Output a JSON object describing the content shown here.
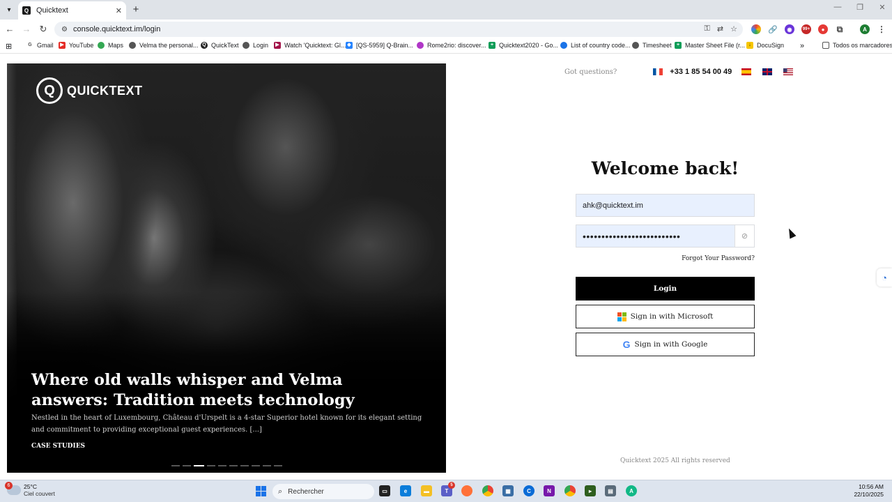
{
  "browser": {
    "tab_title": "Quicktext",
    "url": "console.quicktext.im/login",
    "bookmarks": [
      "Gmail",
      "YouTube",
      "Maps",
      "Velma the personal...",
      "QuickText",
      "Login",
      "Watch 'Quicktext: Gl...",
      "[QS-5959] Q-Brain...",
      "Rome2rio: discover...",
      "Quicktext2020 - Go...",
      "List of country code...",
      "Timesheet",
      "Master Sheet File (r...",
      "DocuSign"
    ],
    "all_bookmarks": "Todos os marcadores",
    "ext_badge": "99+"
  },
  "hero": {
    "logo_text": "QUICKTEXT",
    "title": "Where old walls whisper and Velma answers: Tradition meets technology",
    "description": "Nestled in the heart of Luxembourg, Château d'Urspelt is a 4-star Superior hotel known for its elegant setting and commitment to providing exceptional guest experiences. [...]",
    "tag": "CASE STUDIES",
    "slides_total": 10,
    "slide_active": 3
  },
  "topbar": {
    "got_questions": "Got questions?",
    "phone": "+33 1 85 54 00 49"
  },
  "login": {
    "title": "Welcome back!",
    "email_value": "ahk@quicktext.im",
    "password_value": "••••••••••••••••••••••••••",
    "forgot": "Forgot Your Password?",
    "login_button": "Login",
    "microsoft_button": "Sign in with Microsoft",
    "google_button": "Sign in with Google"
  },
  "footer": "Quicktext 2025 All rights reserved",
  "taskbar": {
    "weather_badge": "6",
    "temperature": "25°C",
    "weather_desc": "Ciel couvert",
    "search_placeholder": "Rechercher",
    "app_badge": "5",
    "time": "10:56 AM",
    "date": "22/10/2025"
  },
  "colors": {
    "accent_black": "#000000",
    "autofill_blue": "#e8f0fe",
    "ms_red": "#f25022",
    "ms_green": "#7fba00",
    "ms_blue": "#00a4ef",
    "ms_yellow": "#ffb900"
  }
}
